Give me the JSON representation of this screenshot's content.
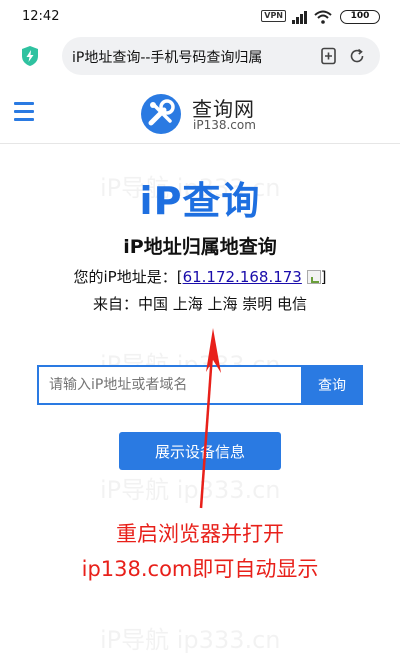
{
  "status_bar": {
    "time": "12:42",
    "vpn": "VPN",
    "battery": "100"
  },
  "browser": {
    "url_title": "iP地址查询--手机号码查询归属",
    "icons": [
      "shield-icon",
      "add-tab-icon",
      "reload-icon"
    ]
  },
  "site": {
    "logo_name": "查询网",
    "logo_domain": "iP138.com",
    "accent_color": "#2a7ae2",
    "watermark": "iP导航  ip333.cn"
  },
  "main": {
    "hero_title": "iP查询",
    "subtitle": "iP地址归属地查询",
    "ip_prefix": "您的iP地址是：[",
    "ip_value": "61.172.168.173",
    "ip_suffix": "]",
    "from_text": "来自：中国 上海 上海 崇明 电信",
    "search_placeholder": "请输入iP地址或者域名",
    "search_button": "查询",
    "device_button": "展示设备信息"
  },
  "annotation": {
    "line1": "重启浏览器并打开",
    "line2": "ip138.com即可自动显示",
    "color": "#e8201a"
  }
}
